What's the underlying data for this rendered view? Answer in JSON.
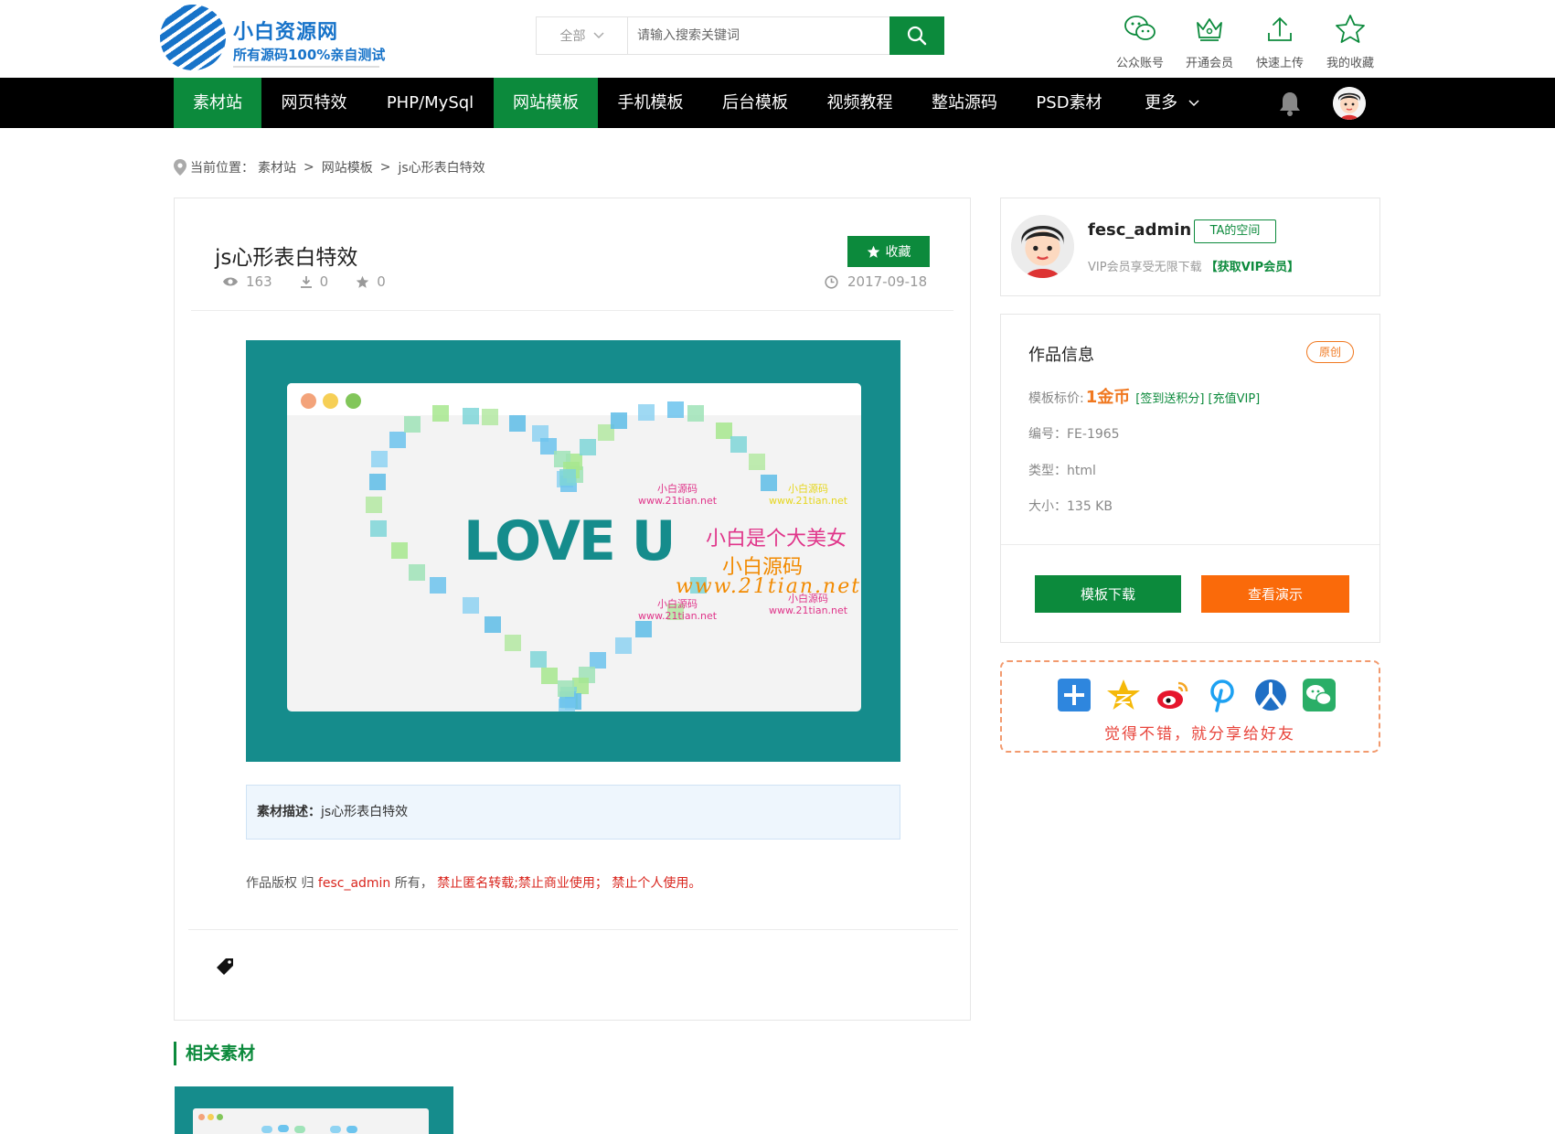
{
  "header": {
    "logo_title": "小白资源网",
    "logo_subtitle": "所有源码100%亲自测试",
    "search": {
      "category": "全部",
      "placeholder": "请输入搜索关键词"
    },
    "quick_links": [
      {
        "label": "公众账号",
        "icon": "wechat-icon"
      },
      {
        "label": "开通会员",
        "icon": "crown-icon"
      },
      {
        "label": "快速上传",
        "icon": "upload-icon"
      },
      {
        "label": "我的收藏",
        "icon": "star-icon"
      }
    ]
  },
  "nav": {
    "items": [
      {
        "label": "素材站",
        "active": true
      },
      {
        "label": "网页特效",
        "active": false
      },
      {
        "label": "PHP/MySql",
        "active": false
      },
      {
        "label": "网站模板",
        "active": true
      },
      {
        "label": "手机模板",
        "active": false
      },
      {
        "label": "后台模板",
        "active": false
      },
      {
        "label": "视频教程",
        "active": false
      },
      {
        "label": "整站源码",
        "active": false
      },
      {
        "label": "PSD素材",
        "active": false
      },
      {
        "label": "更多",
        "active": false
      }
    ]
  },
  "breadcrumb": {
    "prefix": "当前位置：",
    "items": [
      "素材站",
      "网站模板",
      "js心形表白特效"
    ],
    "separator": ">"
  },
  "article": {
    "title": "js心形表白特效",
    "fav_label": "收藏",
    "views": "163",
    "downloads": "0",
    "stars": "0",
    "date": "2017-09-18",
    "preview": {
      "love_text": "LOVE U",
      "wm_pink": "小白是个大美女",
      "wm_orange_1": "小白源码",
      "wm_orange_2": "www.21tian.net",
      "wm_small_1_a": "小白源码",
      "wm_small_1_b": "www.21tian.net",
      "wm_small_2_a": "小白源码",
      "wm_small_2_b": "www.21tian.net",
      "wm_small_3_a": "小白源码",
      "wm_small_3_b": "www.21tian.net",
      "wm_small_4_a": "小白源码",
      "wm_small_4_b": "www.21tian.net"
    },
    "desc_label": "素材描述：",
    "desc_value": "js心形表白特效",
    "copyright_prefix": "作品版权 归",
    "copyright_owner": "fesc_admin",
    "copyright_mid": "所有，",
    "copyright_rules": "禁止匿名转载;禁止商业使用；  禁止个人使用。"
  },
  "related": {
    "title": "相关素材"
  },
  "sidebar": {
    "user": {
      "name": "fesc_admin",
      "space_label": "TA的空间",
      "vip_text": "VIP会员享受无限下载",
      "vip_link": "【获取VIP会员】"
    },
    "info": {
      "title": "作品信息",
      "badge": "原创",
      "price_label": "模板标价:",
      "price_value": "1金币",
      "price_links": "[签到送积分] [充值VIP]",
      "id_label": "编号：",
      "id_value": "FE-1965",
      "type_label": "类型：",
      "type_value": "html",
      "size_label": "大小：",
      "size_value": "135 KB",
      "download_label": "模板下载",
      "demo_label": "查看演示"
    },
    "share": {
      "text": "觉得不错，就分享给好友",
      "icons": [
        "plus-share-icon",
        "qzone-icon",
        "weibo-icon",
        "pinterest-icon",
        "renren-icon",
        "wechat-share-icon"
      ]
    }
  },
  "colors": {
    "brand_green": "#0c8a3c",
    "accent_orange": "#fa6a0a",
    "logo_blue": "#1773c9",
    "preview_teal": "#158c8c",
    "warning_red": "#d9251d"
  }
}
